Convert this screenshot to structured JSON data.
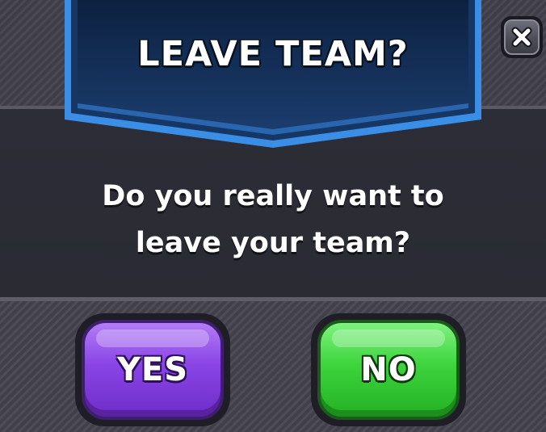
{
  "dialog": {
    "title": "LEAVE TEAM?",
    "message_line1": "Do you really want to",
    "message_line2": "leave your team?",
    "close_icon": "close-x-icon"
  },
  "buttons": {
    "yes_label": "YES",
    "no_label": "NO"
  },
  "colors": {
    "banner": "#14305a",
    "banner_edge": "#3a8ee6",
    "yes_button": "#8a44e6",
    "no_button": "#3dd43d",
    "panel": "#2c2d36"
  }
}
